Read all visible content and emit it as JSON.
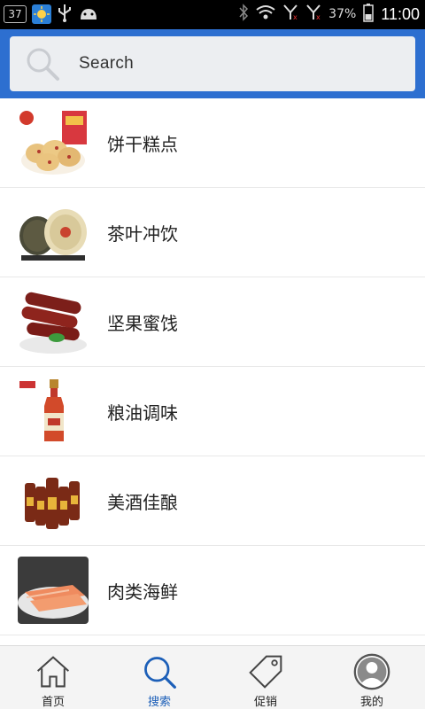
{
  "status_bar": {
    "notification_count": "37",
    "battery_percent": "37%",
    "time": "11:00",
    "icons": [
      "weather-icon",
      "usb-icon",
      "android-icon",
      "bluetooth-icon",
      "wifi-icon",
      "signal-1-icon",
      "signal-2-icon",
      "battery-icon"
    ]
  },
  "search": {
    "placeholder": "Search"
  },
  "categories": [
    {
      "label": "饼干糕点",
      "icon": "cookies-thumbnail"
    },
    {
      "label": "茶叶冲饮",
      "icon": "tea-cake-thumbnail"
    },
    {
      "label": "坚果蜜饯",
      "icon": "fruit-roll-thumbnail"
    },
    {
      "label": "粮油调味",
      "icon": "sauce-bottle-thumbnail"
    },
    {
      "label": "美酒佳酿",
      "icon": "wine-bottles-thumbnail"
    },
    {
      "label": "肉类海鲜",
      "icon": "meat-slices-thumbnail"
    }
  ],
  "bottom_nav": {
    "items": [
      {
        "label": "首页",
        "icon": "home-icon"
      },
      {
        "label": "搜索",
        "icon": "search-icon",
        "active": true
      },
      {
        "label": "促销",
        "icon": "tag-icon"
      },
      {
        "label": "我的",
        "icon": "profile-icon"
      }
    ]
  },
  "colors": {
    "header": "#2d6fd0",
    "active_nav": "#1c5fb8"
  }
}
